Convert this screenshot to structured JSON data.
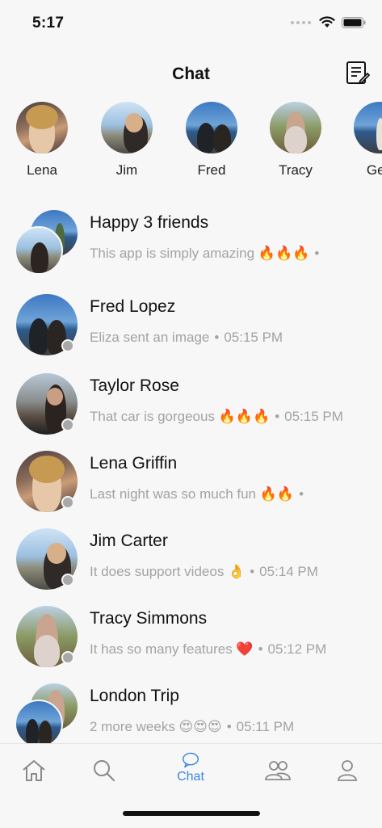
{
  "status": {
    "time": "5:17"
  },
  "header": {
    "title": "Chat"
  },
  "stories": [
    {
      "name": "Lena"
    },
    {
      "name": "Jim"
    },
    {
      "name": "Fred"
    },
    {
      "name": "Tracy"
    },
    {
      "name": "Geo"
    }
  ],
  "chats": [
    {
      "title": "Happy 3 friends",
      "message": "This app is simply amazing 🔥🔥🔥",
      "time": ""
    },
    {
      "title": "Fred Lopez",
      "message": "Eliza sent an image",
      "time": "05:15 PM"
    },
    {
      "title": "Taylor Rose",
      "message": "That car is gorgeous 🔥🔥🔥",
      "time": "05:15 PM"
    },
    {
      "title": "Lena Griffin",
      "message": "Last night was so much fun 🔥🔥",
      "time": ""
    },
    {
      "title": "Jim Carter",
      "message": "It does support videos 👌",
      "time": "05:14 PM"
    },
    {
      "title": "Tracy Simmons",
      "message": "It has so many features ❤️",
      "time": "05:12 PM"
    },
    {
      "title": "London Trip",
      "message": "2 more weeks 😍😍😍",
      "time": "05:11 PM"
    }
  ],
  "tabbar": {
    "chat_label": "Chat"
  },
  "colors": {
    "accent": "#3b86e0",
    "muted": "#a3a3a3",
    "presence": "#a8a8a8"
  }
}
